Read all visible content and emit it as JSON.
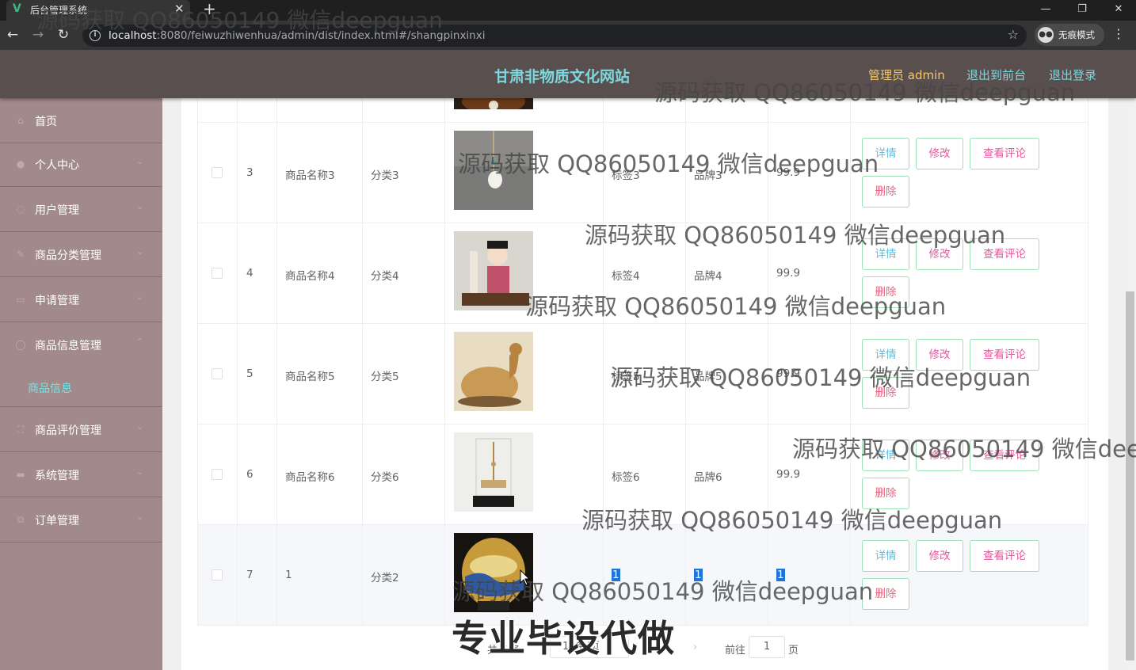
{
  "browser": {
    "tab_title": "后台管理系统",
    "tab_favicon": "V",
    "url_host": "localhost",
    "url_rest": ":8080/feiwuzhiwenhua/admin/dist/index.html#/shangpinxinxi",
    "incognito_label": "无痕模式"
  },
  "header": {
    "site_title": "甘肃非物质文化网站",
    "admin_label": "管理员 admin",
    "front_link": "退出到前台",
    "logout_link": "退出登录"
  },
  "sidebar": {
    "items": [
      {
        "label": "首页",
        "icon": "home-icon"
      },
      {
        "label": "个人中心",
        "icon": "user-icon"
      },
      {
        "label": "用户管理",
        "icon": "users-icon"
      },
      {
        "label": "商品分类管理",
        "icon": "edit-icon"
      },
      {
        "label": "申请管理",
        "icon": "mail-icon"
      },
      {
        "label": "商品信息管理",
        "icon": "info-icon"
      },
      {
        "label": "商品评价管理",
        "icon": "review-icon"
      },
      {
        "label": "系统管理",
        "icon": "system-icon"
      },
      {
        "label": "订单管理",
        "icon": "order-icon"
      }
    ],
    "active_sub": "商品信息"
  },
  "table": {
    "rows": [
      {
        "index": "3",
        "name": "商品名称3",
        "category": "分类3",
        "tag": "标签3",
        "brand": "品牌3",
        "price": "99.9"
      },
      {
        "index": "4",
        "name": "商品名称4",
        "category": "分类4",
        "tag": "标签4",
        "brand": "品牌4",
        "price": "99.9"
      },
      {
        "index": "5",
        "name": "商品名称5",
        "category": "分类5",
        "tag": "标签5",
        "brand": "品牌5",
        "price": "99.9"
      },
      {
        "index": "6",
        "name": "商品名称6",
        "category": "分类6",
        "tag": "标签6",
        "brand": "品牌6",
        "price": "99.9"
      },
      {
        "index": "7",
        "name": "1",
        "category": "分类2",
        "tag": "1",
        "brand": "1",
        "price": "1"
      }
    ],
    "actions": {
      "detail": "详情",
      "edit": "修改",
      "comments": "查看评论",
      "delete": "删除"
    }
  },
  "pagination": {
    "total": "共 7 条",
    "page_size": "10条/页",
    "current_page": "1",
    "goto_prefix": "前往",
    "goto_value": "1",
    "goto_suffix": "页"
  },
  "watermark": {
    "text": "源码获取 QQ86050149 微信deepguan",
    "big_text": "专业毕设代做"
  }
}
